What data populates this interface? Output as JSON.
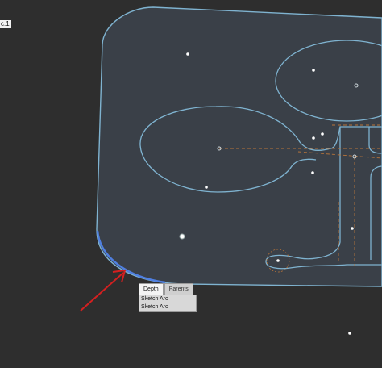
{
  "corner_label": "c.1",
  "popup": {
    "tabs": [
      {
        "label": "Depth",
        "active": true
      },
      {
        "label": "Parents",
        "active": false
      }
    ],
    "items": [
      "Sketch Arc",
      "Sketch Arc"
    ]
  },
  "colors": {
    "background": "#2e2e2e",
    "part_fill": "#3a4048",
    "outline": "#7fb3d0",
    "highlight_arc": "#4f7fe0",
    "construction_line": "#b8743a",
    "annotation_arrow": "#d42020"
  }
}
